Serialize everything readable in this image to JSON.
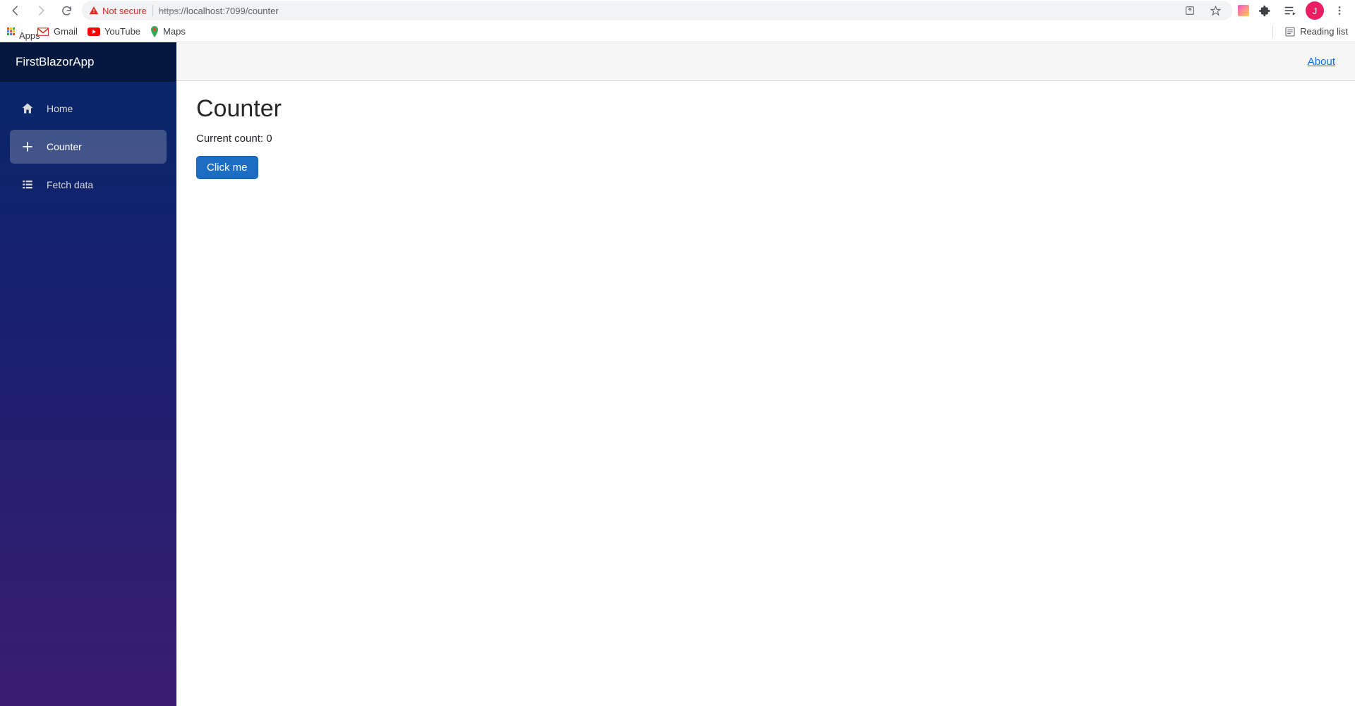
{
  "browser": {
    "not_secure": "Not secure",
    "url_scheme": "https",
    "url_rest": "://localhost:7099/counter",
    "avatar_initial": "J",
    "bookmarks": {
      "apps": "Apps",
      "gmail": "Gmail",
      "youtube": "YouTube",
      "maps": "Maps",
      "reading_list": "Reading list"
    }
  },
  "sidebar": {
    "brand": "FirstBlazorApp",
    "items": [
      {
        "label": "Home",
        "icon": "home-icon",
        "active": false
      },
      {
        "label": "Counter",
        "icon": "plus-icon",
        "active": true
      },
      {
        "label": "Fetch data",
        "icon": "list-icon",
        "active": false
      }
    ]
  },
  "topbar": {
    "about": "About"
  },
  "page": {
    "title": "Counter",
    "count_label": "Current count: ",
    "count_value": "0",
    "button": "Click me"
  }
}
